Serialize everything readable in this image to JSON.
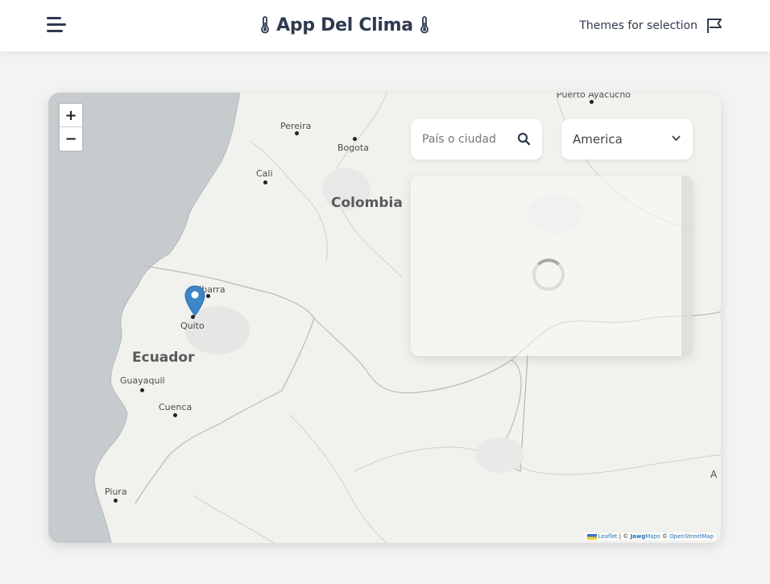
{
  "header": {
    "title": "App Del Clima",
    "themes_label": "Themes for selection"
  },
  "icons": {
    "menu": "hamburger-icon",
    "thermometer": "thermometer-icon",
    "flag": "flag-icon",
    "search": "search-icon",
    "chevron": "chevron-down-icon"
  },
  "map": {
    "zoom_in": "+",
    "zoom_out": "−",
    "search_placeholder": "País o ciudad",
    "region_selected": "America",
    "countries": {
      "colombia": "Colombia",
      "ecuador": "Ecuador"
    },
    "cities": {
      "puerto_ayacucho": "Puerto Ayacucho",
      "pereira": "Pereira",
      "bogota": "Bogota",
      "cali": "Cali",
      "ibarra": "Ibarra",
      "quito": "Quito",
      "guayaquil": "Guayaquil",
      "cuenca": "Cuenca",
      "piura": "Piura"
    },
    "edge_letter": "A",
    "marker_location": "Quito",
    "attribution": {
      "leaflet": "Leaflet",
      "sep": " | © ",
      "jawg": "Jawg",
      "maps": "Maps",
      "osm_prefix": " © ",
      "osm": "OpenStreetMap"
    }
  },
  "colors": {
    "ocean": "#c6ccce",
    "land": "#f1f1ee",
    "marker": "#3d87c8",
    "text_dark": "#2f3a4f"
  }
}
